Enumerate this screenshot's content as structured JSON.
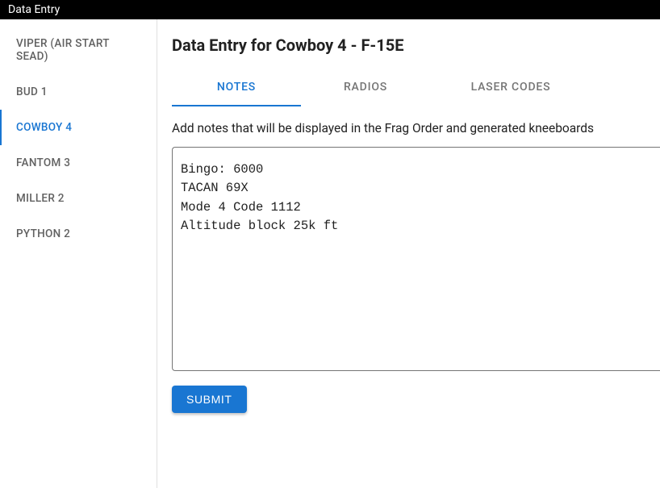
{
  "header": {
    "title": "Data Entry"
  },
  "sidebar": {
    "items": [
      {
        "label": "VIPER (AIR START SEAD)",
        "selected": false
      },
      {
        "label": "BUD 1",
        "selected": false
      },
      {
        "label": "COWBOY 4",
        "selected": true
      },
      {
        "label": "FANTOM 3",
        "selected": false
      },
      {
        "label": "MILLER 2",
        "selected": false
      },
      {
        "label": "PYTHON 2",
        "selected": false
      }
    ]
  },
  "main": {
    "title": "Data Entry for Cowboy 4 - F-15E",
    "tabs": [
      {
        "label": "NOTES",
        "selected": true
      },
      {
        "label": "RADIOS",
        "selected": false
      },
      {
        "label": "LASER CODES",
        "selected": false
      }
    ],
    "description": "Add notes that will be displayed in the Frag Order and generated kneeboards",
    "notes_value": "Bingo: 6000\nTACAN 69X\nMode 4 Code 1112\nAltitude block 25k ft",
    "submit_label": "SUBMIT"
  }
}
